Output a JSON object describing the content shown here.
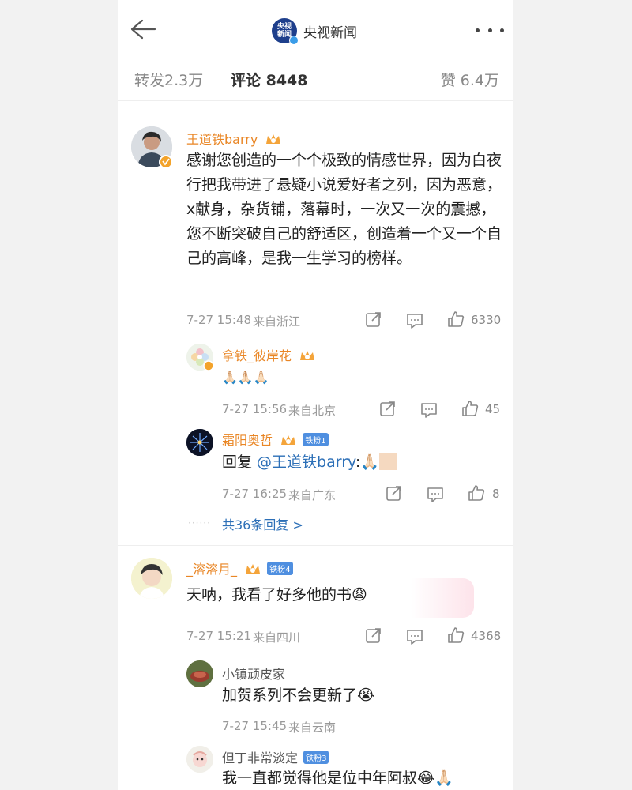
{
  "header": {
    "title": "央视新闻",
    "logo_text": "央视新闻"
  },
  "tabs": {
    "forward": "转发2.3万",
    "comment": "评论 8448",
    "like": "赞 6.4万"
  },
  "comments": [
    {
      "name": "王道铁barry",
      "text": "感谢您创造的一个个极致的情感世界，因为白夜行把我带进了悬疑小说爱好者之列，因为恶意，x献身，杂货铺，落幕时，一次又一次的震撼，您不断突破自己的舒适区，创造着一个又一个自己的高峰，是我一生学习的榜样。",
      "time": "7-27 15:48",
      "location": "来自浙江",
      "likes": "6330",
      "replies": [
        {
          "name": "拿铁_彼岸花",
          "text": "🙏🏻🙏🏻🙏🏻",
          "time": "7-27 15:56",
          "location": "来自北京",
          "likes": "45"
        },
        {
          "name": "霜阳奥哲",
          "badge": "铁粉1",
          "text_prefix": "回复 ",
          "mention": "@王道铁barry",
          "text_suffix": ":🙏🏻",
          "time": "7-27 16:25",
          "location": "来自广东",
          "likes": "8"
        }
      ],
      "more_replies": "共36条回复 >"
    },
    {
      "name": "_溶溶月_",
      "badge": "铁粉4",
      "text": "天呐，我看了好多他的书😩",
      "time": "7-27 15:21",
      "location": "来自四川",
      "likes": "4368",
      "replies": [
        {
          "name": "小镇顽皮家",
          "text": "加贺系列不会更新了😭",
          "time": "7-27 15:45",
          "location": "来自云南",
          "likes": ""
        },
        {
          "name": "但丁非常淡定",
          "badge": "铁粉3",
          "text": "我一直都觉得他是位中年阿叔😂🙏🏻"
        }
      ]
    }
  ],
  "colors": {
    "name_orange": "#e98625",
    "link_blue": "#2c6fb7",
    "meta_grey": "#999999"
  }
}
